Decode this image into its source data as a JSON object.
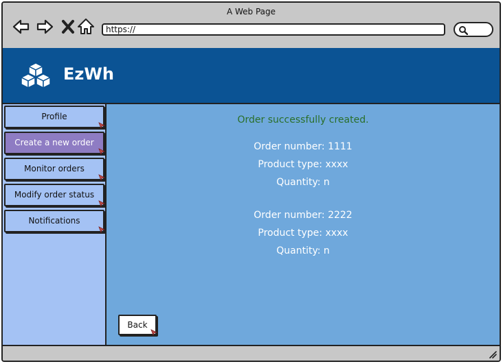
{
  "window": {
    "title": "A Web Page"
  },
  "browser": {
    "url": "https://"
  },
  "app": {
    "name": "EzWh"
  },
  "sidebar": {
    "items": [
      {
        "label": "Profile"
      },
      {
        "label": "Create a new order"
      },
      {
        "label": "Monitor orders"
      },
      {
        "label": "Modify order status"
      },
      {
        "label": "Notifications"
      }
    ]
  },
  "main": {
    "success_message": "Order successfully created.",
    "orders": [
      {
        "number": "Order number: 1111",
        "product": "Product type: xxxx",
        "quantity": "Quantity: n"
      },
      {
        "number": "Order number: 2222",
        "product": "Product type: xxxx",
        "quantity": "Quantity: n"
      }
    ],
    "back_label": "Back"
  },
  "colors": {
    "header": "#0b5394",
    "sidebar": "#a4c2f4",
    "active_item": "#8e7cc3",
    "main": "#6fa8dc",
    "success_text": "#2a6f2a"
  }
}
